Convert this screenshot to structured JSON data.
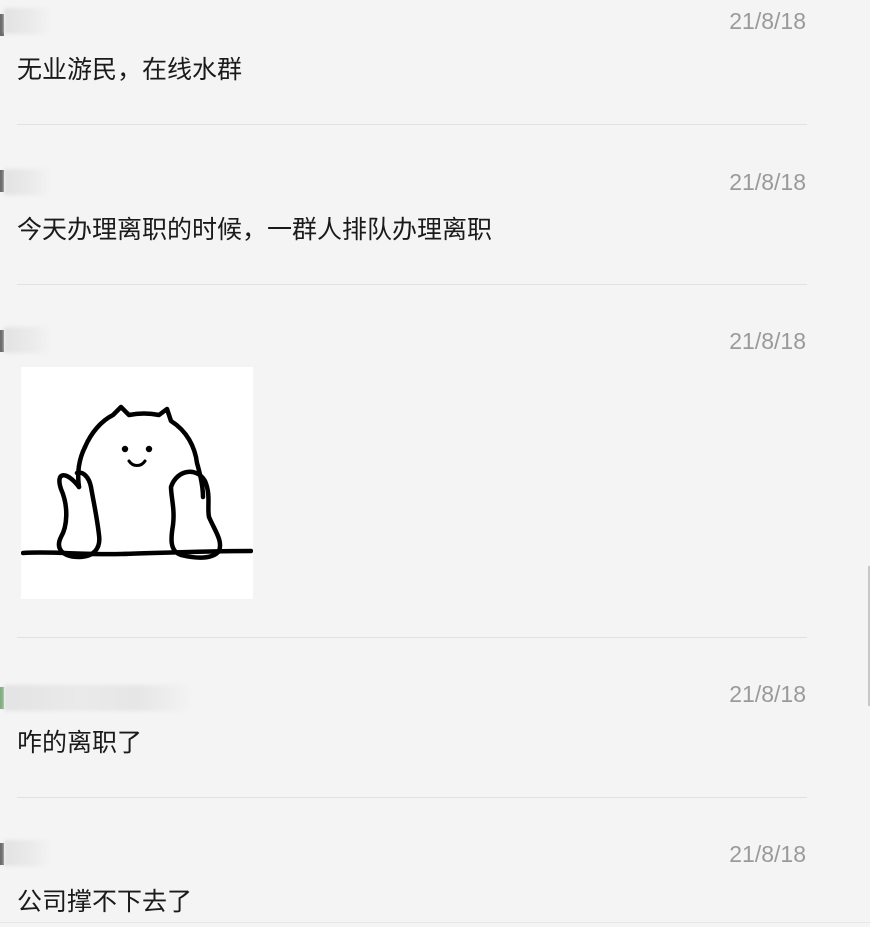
{
  "messages": [
    {
      "date": "21/8/18",
      "text": "无业游民，在线水群"
    },
    {
      "date": "21/8/18",
      "text": "今天办理离职的时候，一群人排队办理离职"
    },
    {
      "date": "21/8/18",
      "sticker": "cat-leaning-sticker"
    },
    {
      "date": "21/8/18",
      "text": "咋的离职了"
    },
    {
      "date": "21/8/18",
      "text": "公司撑不下去了"
    }
  ],
  "colors": {
    "background": "#f4f4f4",
    "text": "#1a1a1a",
    "date": "#9a9a9a",
    "divider": "#e1e1e1"
  }
}
